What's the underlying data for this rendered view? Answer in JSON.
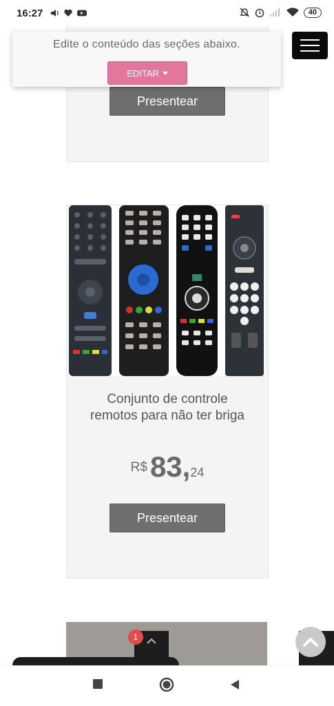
{
  "status_bar": {
    "time": "16:27",
    "battery": "40",
    "icons": [
      "volume-icon",
      "heart-icon",
      "youtube-icon",
      "mute-icon",
      "alarm-icon",
      "signal-icon",
      "wifi-icon",
      "battery-icon"
    ]
  },
  "editor": {
    "message": "Edite o conteúdo das seções abaixo.",
    "edit_label": "EDITAR",
    "accent": "#e3769d"
  },
  "menu": {
    "icon": "hamburger-icon"
  },
  "products": [
    {
      "button_label": "Presentear"
    },
    {
      "title": "Conjunto de controle\nremotos para não ter briga",
      "currency": "R$",
      "price_int": "83,",
      "price_cents": "24",
      "button_label": "Presentear",
      "image": "tv-remote-controls-photo"
    }
  ],
  "chat": {
    "badge": "1",
    "icon": "chevron-up-icon"
  },
  "scroll_top": {
    "icon": "arrow-up-icon"
  },
  "nav": {
    "icons": [
      "recent-apps-icon",
      "home-icon",
      "back-icon"
    ]
  }
}
